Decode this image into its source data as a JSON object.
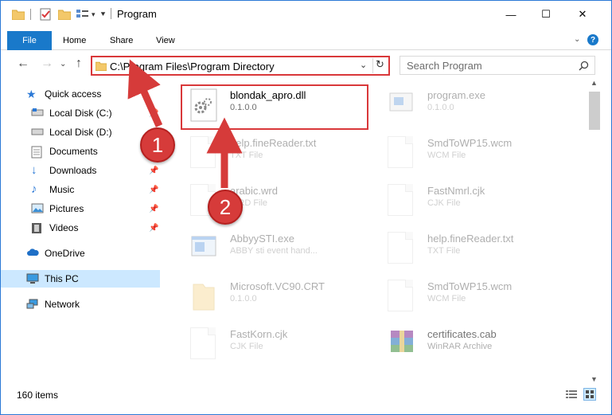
{
  "window": {
    "title": "Program",
    "controls": {
      "minimize": "—",
      "maximize": "☐",
      "close": "✕"
    }
  },
  "ribbon": {
    "tabs": [
      "File",
      "Home",
      "Share",
      "View"
    ],
    "help": "?"
  },
  "navbar": {
    "address": "C:\\Program Files\\Program Directory",
    "search_placeholder": "Search Program"
  },
  "sidebar": {
    "items": [
      {
        "label": "Quick access",
        "icon": "star-icon",
        "pinned": false
      },
      {
        "label": "Local Disk (C:)",
        "icon": "drive-icon",
        "pinned": true
      },
      {
        "label": "Local Disk (D:)",
        "icon": "drive-icon",
        "pinned": false
      },
      {
        "label": "Documents",
        "icon": "documents-icon",
        "pinned": true
      },
      {
        "label": "Downloads",
        "icon": "downloads-icon",
        "pinned": true
      },
      {
        "label": "Music",
        "icon": "music-icon",
        "pinned": true
      },
      {
        "label": "Pictures",
        "icon": "pictures-icon",
        "pinned": true
      },
      {
        "label": "Videos",
        "icon": "videos-icon",
        "pinned": true
      },
      {
        "label": "OneDrive",
        "icon": "cloud-icon",
        "pinned": false
      },
      {
        "label": "This PC",
        "icon": "computer-icon",
        "pinned": false,
        "selected": true
      },
      {
        "label": "Network",
        "icon": "network-icon",
        "pinned": false
      }
    ]
  },
  "files": [
    {
      "name": "blondak_apro.dll",
      "sub": "0.1.0.0",
      "icon": "dll-gear-icon",
      "highlighted": true
    },
    {
      "name": "program.exe",
      "sub": "0.1.0.0",
      "icon": "exe-icon"
    },
    {
      "name": "help.fineReader.txt",
      "sub": "TXT File",
      "icon": "text-file-icon"
    },
    {
      "name": "SmdToWP15.wcm",
      "sub": "WCM File",
      "icon": "file-icon"
    },
    {
      "name": "arabic.wrd",
      "sub": "WRD File",
      "icon": "file-icon"
    },
    {
      "name": "FastNmrl.cjk",
      "sub": "CJK File",
      "icon": "file-icon"
    },
    {
      "name": "AbbyySTI.exe",
      "sub": "ABBY sti event hand...",
      "icon": "exe-blue-icon"
    },
    {
      "name": "help.fineReader.txt",
      "sub": "TXT File",
      "icon": "text-file-icon"
    },
    {
      "name": "Microsoft.VC90.CRT",
      "sub": "0.1.0.0",
      "icon": "folder-icon"
    },
    {
      "name": "SmdToWP15.wcm",
      "sub": "WCM File",
      "icon": "file-icon"
    },
    {
      "name": "FastKorn.cjk",
      "sub": "CJK File",
      "icon": "file-icon"
    },
    {
      "name": "certificates.cab",
      "sub": "WinRAR Archive",
      "icon": "winrar-icon"
    }
  ],
  "annotations": [
    "1",
    "2"
  ],
  "status": {
    "items_count": "160 items"
  },
  "colors": {
    "accent": "#1979ca",
    "annotation_red": "#d63b3a",
    "selected_bg": "#cce8ff"
  }
}
